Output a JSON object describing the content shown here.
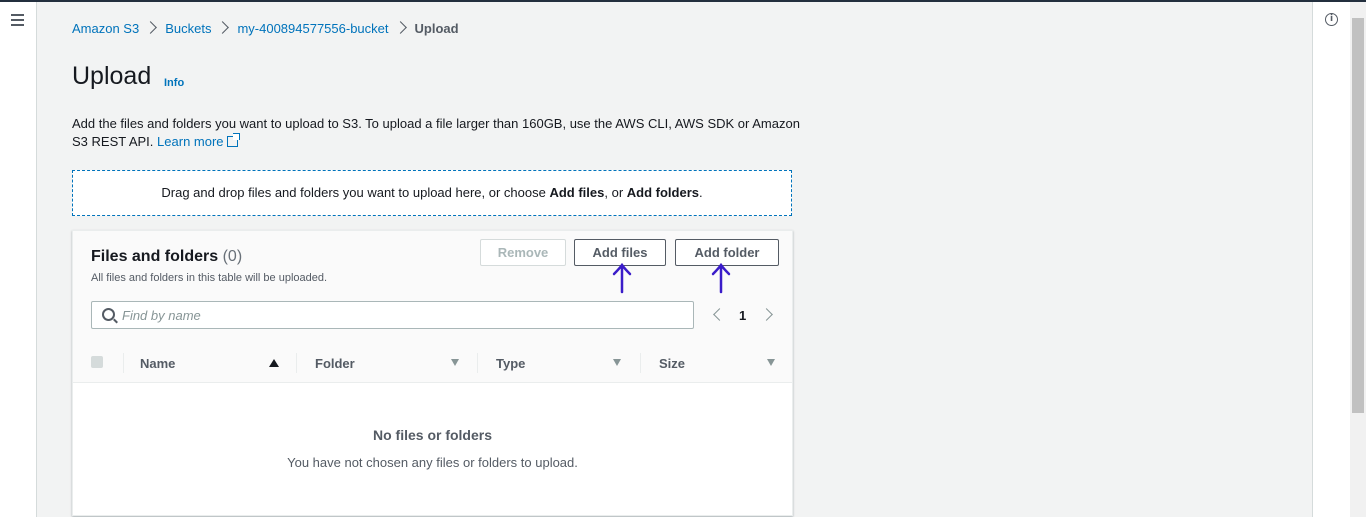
{
  "breadcrumb": [
    "Amazon S3",
    "Buckets",
    "my-400894577556-bucket",
    "Upload"
  ],
  "page": {
    "title": "Upload",
    "info_link": "Info",
    "description": "Add the files and folders you want to upload to S3. To upload a file larger than 160GB, use the AWS CLI, AWS SDK or Amazon S3 REST API.",
    "learn_more": "Learn more"
  },
  "dropzone": {
    "text_prefix": "Drag and drop files and folders you want to upload here, or choose ",
    "add_files": "Add files",
    "text_middle": ", or ",
    "add_folders": "Add folders",
    "text_suffix": "."
  },
  "panel": {
    "title": "Files and folders",
    "count": "(0)",
    "subtitle": "All files and folders in this table will be uploaded.",
    "remove_label": "Remove",
    "add_files_label": "Add files",
    "add_folder_label": "Add folder",
    "search_placeholder": "Find by name",
    "page_number": "1",
    "columns": [
      "Name",
      "Folder",
      "Type",
      "Size"
    ],
    "empty_title": "No files or folders",
    "empty_subtitle": "You have not chosen any files or folders to upload."
  },
  "colors": {
    "link": "#0073bb",
    "annotation": "#3a1cc9"
  }
}
